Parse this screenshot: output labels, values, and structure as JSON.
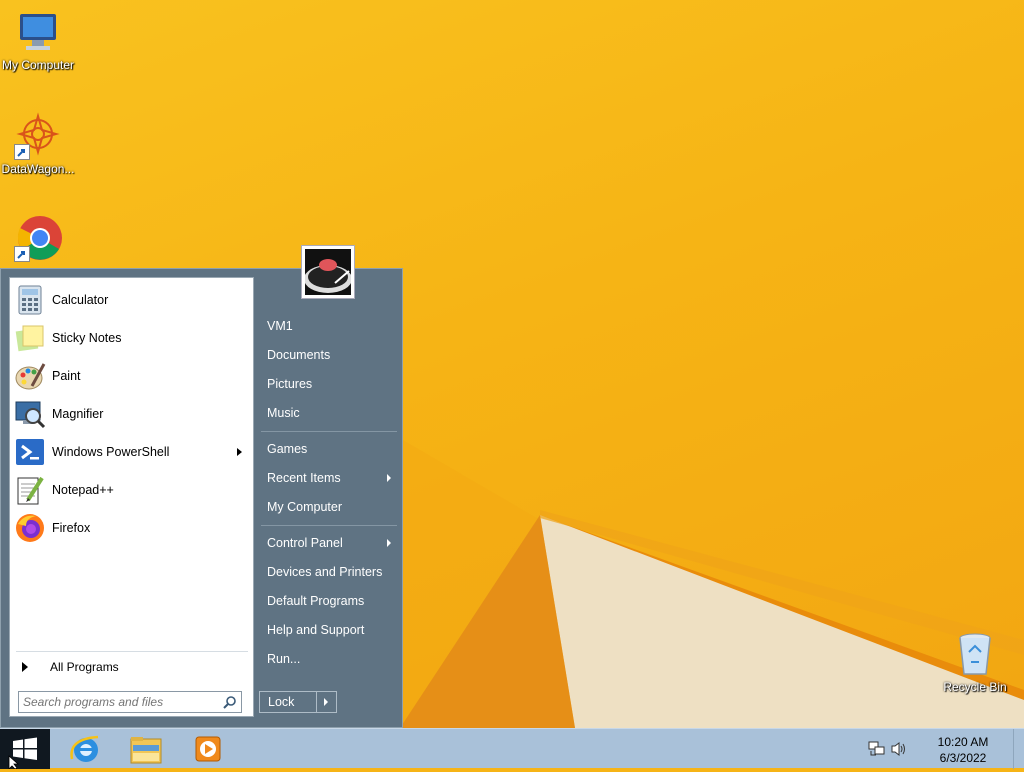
{
  "desktop": {
    "icons": [
      {
        "label": "My Computer",
        "icon": "computer-icon"
      },
      {
        "label": "DataWagon...",
        "icon": "datawagon-icon"
      },
      {
        "label": "",
        "icon": "chrome-icon"
      },
      {
        "label": "Recycle Bin",
        "icon": "recycle-bin-icon"
      }
    ]
  },
  "start_menu": {
    "pinned_programs": [
      {
        "label": "Calculator",
        "icon": "calculator-icon"
      },
      {
        "label": "Sticky Notes",
        "icon": "sticky-notes-icon"
      },
      {
        "label": "Paint",
        "icon": "paint-icon"
      },
      {
        "label": "Magnifier",
        "icon": "magnifier-icon"
      },
      {
        "label": "Windows PowerShell",
        "icon": "powershell-icon",
        "has_submenu": true
      },
      {
        "label": "Notepad++",
        "icon": "notepadpp-icon"
      },
      {
        "label": "Firefox",
        "icon": "firefox-icon"
      }
    ],
    "all_programs_label": "All Programs",
    "search_placeholder": "Search programs and files",
    "right_items": [
      {
        "label": "VM1"
      },
      {
        "label": "Documents"
      },
      {
        "label": "Pictures"
      },
      {
        "label": "Music"
      },
      {
        "label": "Games"
      },
      {
        "label": "Recent Items",
        "has_submenu": true
      },
      {
        "label": "My Computer"
      },
      {
        "label": "Control Panel",
        "has_submenu": true
      },
      {
        "label": "Devices and Printers"
      },
      {
        "label": "Default Programs"
      },
      {
        "label": "Help and Support"
      },
      {
        "label": "Run..."
      }
    ],
    "lock_label": "Lock"
  },
  "taskbar": {
    "apps": [
      {
        "icon": "internet-explorer-icon"
      },
      {
        "icon": "file-explorer-icon"
      },
      {
        "icon": "media-player-icon"
      }
    ],
    "tray_icons": [
      "network-icon",
      "volume-icon"
    ],
    "time": "10:20 AM",
    "date": "6/3/2022"
  },
  "colors": {
    "wallpaper": "#f6b417",
    "start_menu_bg": "#5f7383",
    "taskbar_bg": "#a9c1d9"
  }
}
